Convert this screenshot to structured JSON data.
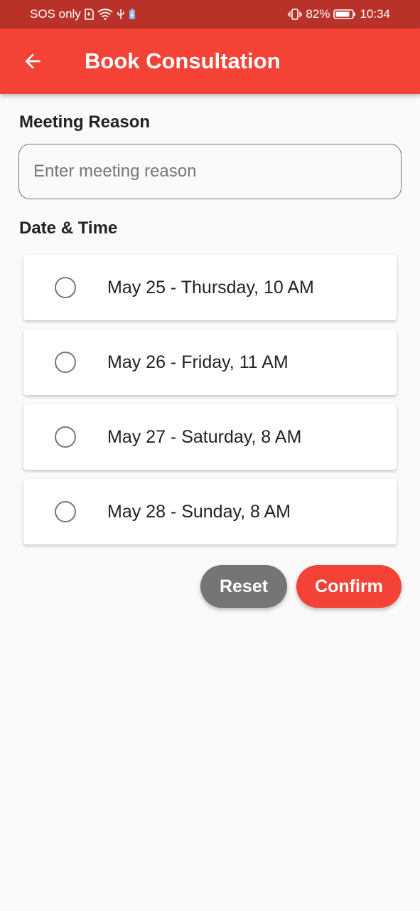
{
  "status_bar": {
    "carrier": "SOS only",
    "battery_percent": "82%",
    "time": "10:34"
  },
  "app_bar": {
    "title": "Book Consultation",
    "back_icon": "arrow-back-icon"
  },
  "form": {
    "reason_label": "Meeting Reason",
    "reason_placeholder": "Enter meeting reason",
    "reason_value": "",
    "datetime_label": "Date & Time",
    "slots": [
      {
        "label": "May 25 - Thursday, 10 AM",
        "selected": false
      },
      {
        "label": "May 26 - Friday, 11 AM",
        "selected": false
      },
      {
        "label": "May 27 - Saturday, 8 AM",
        "selected": false
      },
      {
        "label": "May 28 - Sunday, 8 AM",
        "selected": false
      }
    ]
  },
  "actions": {
    "reset_label": "Reset",
    "confirm_label": "Confirm"
  },
  "colors": {
    "primary": "#f44336",
    "status_bar": "#b83229",
    "reset": "#757575"
  }
}
